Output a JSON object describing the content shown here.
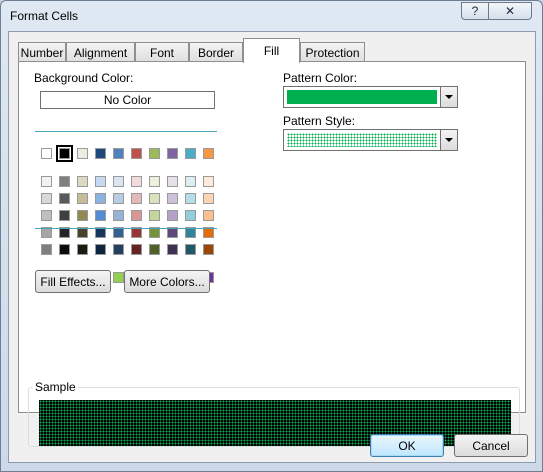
{
  "window": {
    "title": "Format Cells",
    "help_glyph": "?",
    "close_glyph": "✕"
  },
  "tabs": [
    {
      "label": "Number"
    },
    {
      "label": "Alignment"
    },
    {
      "label": "Font"
    },
    {
      "label": "Border"
    },
    {
      "label": "Fill",
      "active": true
    },
    {
      "label": "Protection"
    }
  ],
  "fill": {
    "background_color_label": "Background Color:",
    "no_color_label": "No Color",
    "fill_effects_label": "Fill Effects...",
    "more_colors_label": "More Colors...",
    "pattern_color_label": "Pattern Color:",
    "pattern_color_value": "#00b050",
    "pattern_style_label": "Pattern Style:",
    "sample_label": "Sample"
  },
  "palette": {
    "theme_top": [
      "#ffffff",
      "#000000",
      "#eeece1",
      "#1f497d",
      "#4f81bd",
      "#c0504d",
      "#9bbb59",
      "#8064a2",
      "#4bacc6",
      "#f79646"
    ],
    "selected_index": 1,
    "theme_tints": [
      [
        "#f2f2f2",
        "#7f7f7f",
        "#ddd9c3",
        "#c6d9f0",
        "#dbe5f1",
        "#f2dcdb",
        "#ebf1dd",
        "#e5e0ec",
        "#dbeef3",
        "#fdeada"
      ],
      [
        "#d8d8d8",
        "#595959",
        "#c4bd97",
        "#8db3e2",
        "#b8cce4",
        "#e5b9b7",
        "#d7e3bc",
        "#ccc1d9",
        "#b7dde8",
        "#fbd5b5"
      ],
      [
        "#bfbfbf",
        "#3f3f3f",
        "#938953",
        "#548dd4",
        "#95b3d7",
        "#d99694",
        "#c3d69b",
        "#b2a2c7",
        "#92cddc",
        "#fac08f"
      ],
      [
        "#a5a5a5",
        "#262626",
        "#494429",
        "#17365d",
        "#366092",
        "#953734",
        "#76923c",
        "#5f497a",
        "#31859b",
        "#e36c09"
      ],
      [
        "#7f7f7f",
        "#0c0c0c",
        "#1d1b10",
        "#0f243e",
        "#244061",
        "#632423",
        "#4f6128",
        "#3f3151",
        "#205867",
        "#974806"
      ]
    ],
    "standard": [
      "#c00000",
      "#ff0000",
      "#ffc000",
      "#ffff00",
      "#92d050",
      "#00b050",
      "#00b0f0",
      "#0070c0",
      "#002060",
      "#7030a0"
    ]
  },
  "footer": {
    "ok_label": "OK",
    "cancel_label": "Cancel"
  }
}
